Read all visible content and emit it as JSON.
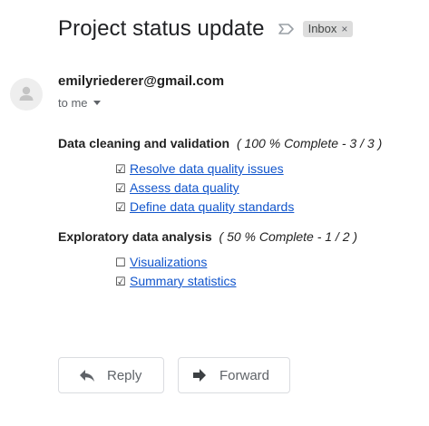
{
  "email": {
    "subject": "Project status update",
    "label_chip": {
      "text": "Inbox",
      "close_glyph": "×"
    },
    "important_marker_icon": "label-arrow-outline-icon",
    "sender": "emilyriederer@gmail.com",
    "recipient_text": "to me",
    "avatar_icon": "person-avatar-icon"
  },
  "sections": [
    {
      "name": "Data cleaning and validation",
      "status": "( 100 % Complete - 3 / 3 )",
      "tasks": [
        {
          "checkbox": "☑",
          "done": true,
          "label": "Resolve data quality issues"
        },
        {
          "checkbox": "☑",
          "done": true,
          "label": "Assess data quality"
        },
        {
          "checkbox": "☑",
          "done": true,
          "label": "Define data quality standards"
        }
      ]
    },
    {
      "name": "Exploratory data analysis",
      "status": "( 50 % Complete - 1 / 2 )",
      "tasks": [
        {
          "checkbox": "☐",
          "done": false,
          "label": "Visualizations"
        },
        {
          "checkbox": "☑",
          "done": true,
          "label": "Summary statistics"
        }
      ]
    }
  ],
  "actions": {
    "reply_label": "Reply",
    "reply_icon": "reply-arrow-icon",
    "forward_label": "Forward",
    "forward_icon": "forward-arrow-icon"
  },
  "colors": {
    "link": "#1155cc",
    "chip_background": "#dddddd",
    "button_border": "#dadce0",
    "muted_text": "#5f6368"
  }
}
